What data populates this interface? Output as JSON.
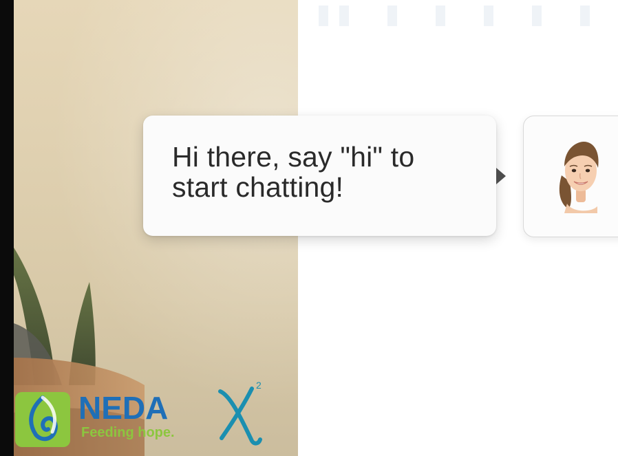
{
  "chat": {
    "greeting_line1": "Hi there, say \"hi\" to",
    "greeting_line2": "start chatting!"
  },
  "avatar": {
    "icon": "assistant-avatar-icon"
  },
  "logos": {
    "neda_name": "NEDA",
    "neda_tagline": "Feeding hope.",
    "partner_mark": "X",
    "partner_superscript": "2"
  },
  "colors": {
    "neda_green": "#8cc63f",
    "neda_blue": "#1f6fb7",
    "partner_teal": "#1b8fb0",
    "bubble_bg": "#fbfbfb",
    "arrow": "#4d4d4d"
  }
}
